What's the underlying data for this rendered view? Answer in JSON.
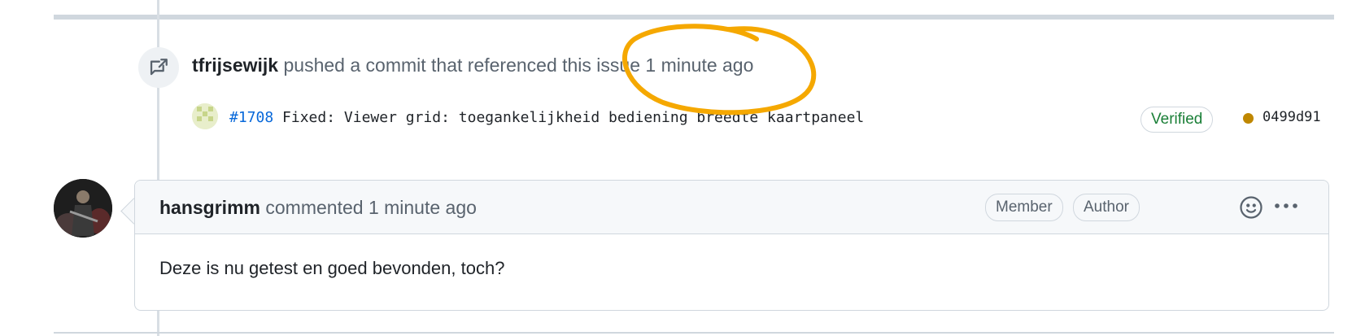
{
  "event": {
    "actor": "tfrijsewijk",
    "action": "pushed a commit that referenced this issue",
    "time": "1 minute ago",
    "icon": "cross-reference-icon"
  },
  "commit": {
    "number": "#1708",
    "message": "Fixed: Viewer grid: toegankelijkheid bediening breedte kaartpaneel",
    "verified_label": "Verified",
    "status_color": "#bf8700",
    "sha": "0499d91"
  },
  "comment": {
    "author": "hansgrimm",
    "action": "commented",
    "time": "1 minute ago",
    "roles": [
      "Member",
      "Author"
    ],
    "body": "Deze is nu getest en goed bevonden, toch?",
    "emoji_icon": "smiley-icon",
    "more_icon": "kebab-horizontal-icon"
  },
  "colors": {
    "annotation": "#f5a800",
    "link": "#0969da",
    "verified": "#1a7f37"
  }
}
